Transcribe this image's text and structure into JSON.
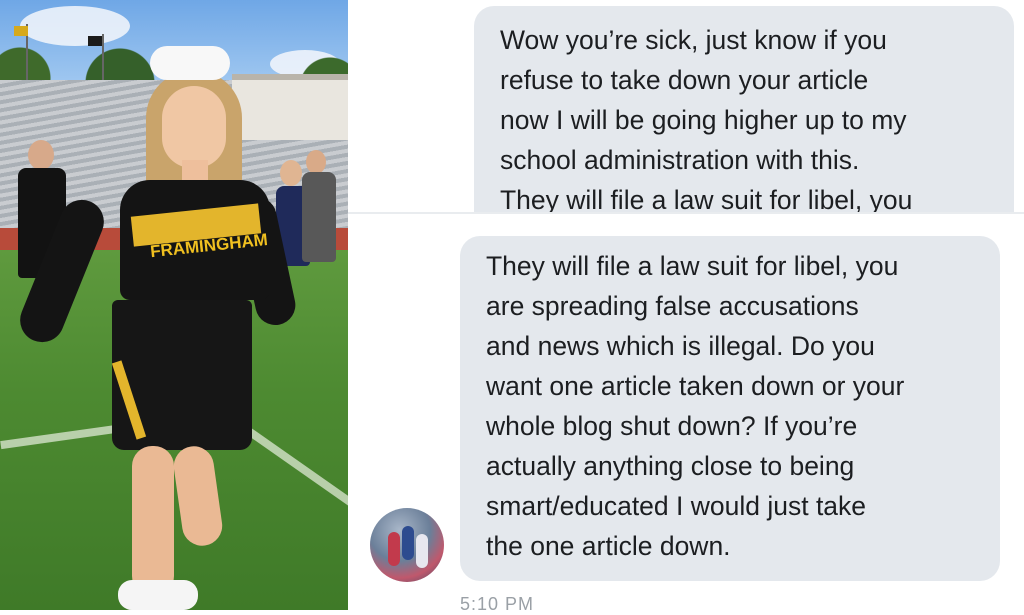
{
  "photo": {
    "jersey_text": "FRAMINGHAM"
  },
  "chat": {
    "message_top": [
      "Wow you’re sick, just know if you",
      "refuse to take down your article",
      "now I will be going higher up to my",
      "school administration with this.",
      "They will file a law suit for libel, you"
    ],
    "message_bottom": [
      "They will file a law suit for libel, you",
      "are spreading false accusations",
      "and news which is illegal. Do you",
      "want one article taken down or your",
      "whole blog shut down? If you’re",
      "actually anything close to being",
      "smart/educated I would just take",
      "the one article down."
    ],
    "timestamp": "5:10 PM"
  },
  "colors": {
    "bubble": "#e4e8ed",
    "text": "#1c1e21",
    "jersey_gold": "#e3b52c",
    "uniform_black": "#141414"
  }
}
